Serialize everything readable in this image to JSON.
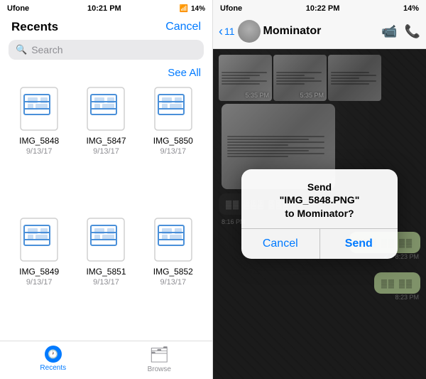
{
  "leftPanel": {
    "statusBar": {
      "carrier": "Ufone",
      "time": "10:21 PM",
      "battery": "14%"
    },
    "title": "Recents",
    "cancelButton": "Cancel",
    "search": {
      "placeholder": "Search"
    },
    "seeAll": "See All",
    "files": [
      {
        "name": "IMG_5848",
        "date": "9/13/17"
      },
      {
        "name": "IMG_5847",
        "date": "9/13/17"
      },
      {
        "name": "IMG_5850",
        "date": "9/13/17"
      },
      {
        "name": "IMG_5849",
        "date": "9/13/17"
      },
      {
        "name": "IMG_5851",
        "date": "9/13/17"
      },
      {
        "name": "IMG_5852",
        "date": "9/13/17"
      }
    ],
    "tabs": [
      {
        "label": "Recents",
        "active": true
      },
      {
        "label": "Browse",
        "active": false
      }
    ]
  },
  "rightPanel": {
    "statusBar": {
      "carrier": "Ufone",
      "time": "10:22 PM",
      "battery": "14%"
    },
    "backCount": "11",
    "chatName": "Mominator",
    "timestamps": {
      "img1": "5:35 PM",
      "img2": "5:35 PM",
      "msg1": "8:16 PM",
      "msg2": "8:23 PM",
      "msg3": "8:23 PM"
    },
    "dialog": {
      "title": "Send",
      "filename": "\"IMG_5848.PNG\"",
      "subtitle": "to Mominator?",
      "cancelButton": "Cancel",
      "sendButton": "Send"
    }
  }
}
